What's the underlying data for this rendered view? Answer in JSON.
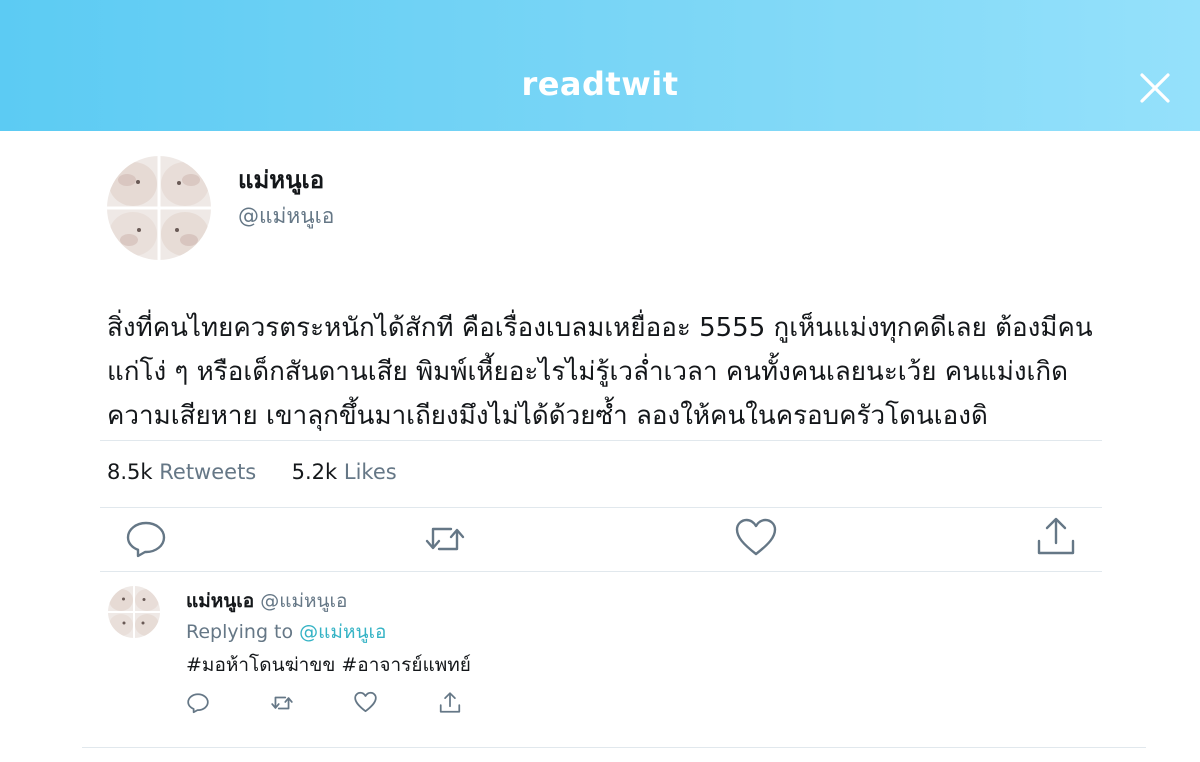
{
  "header": {
    "brand": "readtwit",
    "close_icon": "close-icon"
  },
  "tweet": {
    "author": {
      "name": "แม่หนูเอ",
      "handle": "@แม่หนูเอ",
      "avatar": "bunny-collage-avatar"
    },
    "text_lines": [
      "สิ่งที่คนไทยควรตระหนักได้สักที คือเรื่องเบลมเหยื่ออะ 5555 กูเห็นแม่งทุกคดีเลย ต้องมีคน",
      "แก่โง่ ๆ หรือเด็กสันดานเสีย พิมพ์เหี้ยอะไรไม่รู้เวล่ำเวลา คนทั้งคนเลยนะเว้ย คนแม่งเกิด",
      "ความเสียหาย เขาลุกขึ้นมาเถียงมึงไม่ได้ด้วยซ้ำ ลองให้คนในครอบครัวโดนเองดิ"
    ],
    "stats": {
      "retweets_count": "8.5k",
      "retweets_label": "Retweets",
      "likes_count": "5.2k",
      "likes_label": "Likes"
    },
    "actions": [
      "reply-icon",
      "retweet-icon",
      "like-icon",
      "share-icon"
    ]
  },
  "reply": {
    "name": "แม่หนูเอ",
    "handle": "@แม่หนูเอ",
    "replying_prefix": "Replying to",
    "replying_to": "@แม่หนูเอ",
    "text": "#มอห้าโดนฆ่าขข #อาจารย์แพทย์",
    "actions": [
      "reply-icon",
      "retweet-icon",
      "like-icon",
      "share-icon"
    ]
  },
  "colors": {
    "header_gradient_start": "#5ccbf3",
    "header_gradient_end": "#95e1fb",
    "icon_gray": "#657786",
    "link": "#35b3c5",
    "divider": "#e1e8ed"
  }
}
